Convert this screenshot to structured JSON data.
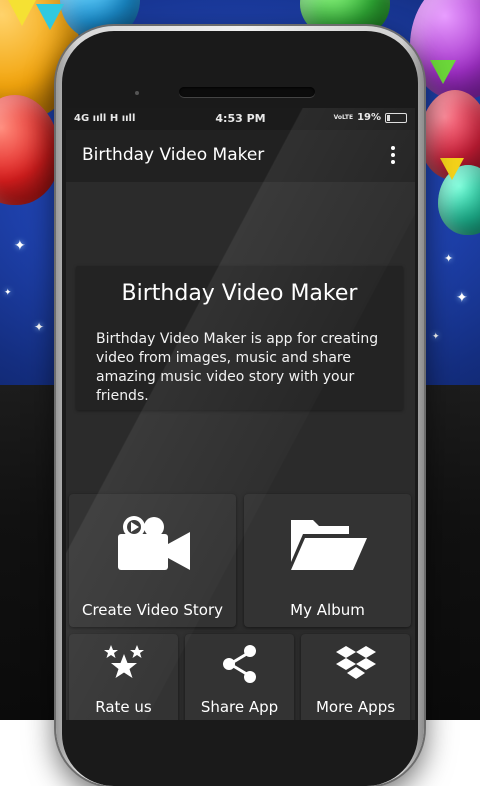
{
  "status_bar": {
    "network": "4G ııll H ııll",
    "time": "4:53 PM",
    "volte": "VoLTE",
    "battery": "19%",
    "battery_level": 0.19
  },
  "app_bar": {
    "title": "Birthday Video Maker",
    "overflow_icon": "more-vert-icon"
  },
  "info_card": {
    "heading": "Birthday Video Maker",
    "description": "Birthday Video Maker is app for creating video from images, music and share amazing music video story with your friends."
  },
  "actions": [
    {
      "label": "Create Video Story",
      "icon": "video-camera-icon"
    },
    {
      "label": "My Album",
      "icon": "folder-open-icon"
    },
    {
      "label": "Rate us",
      "icon": "stars-icon"
    },
    {
      "label": "Share App",
      "icon": "share-icon"
    },
    {
      "label": "More Apps",
      "icon": "dropbox-icon"
    }
  ],
  "colors": {
    "screen_bg": "#2b2b2b",
    "tile_bg": "#333333",
    "backdrop_blue": "#1d3fa8"
  }
}
